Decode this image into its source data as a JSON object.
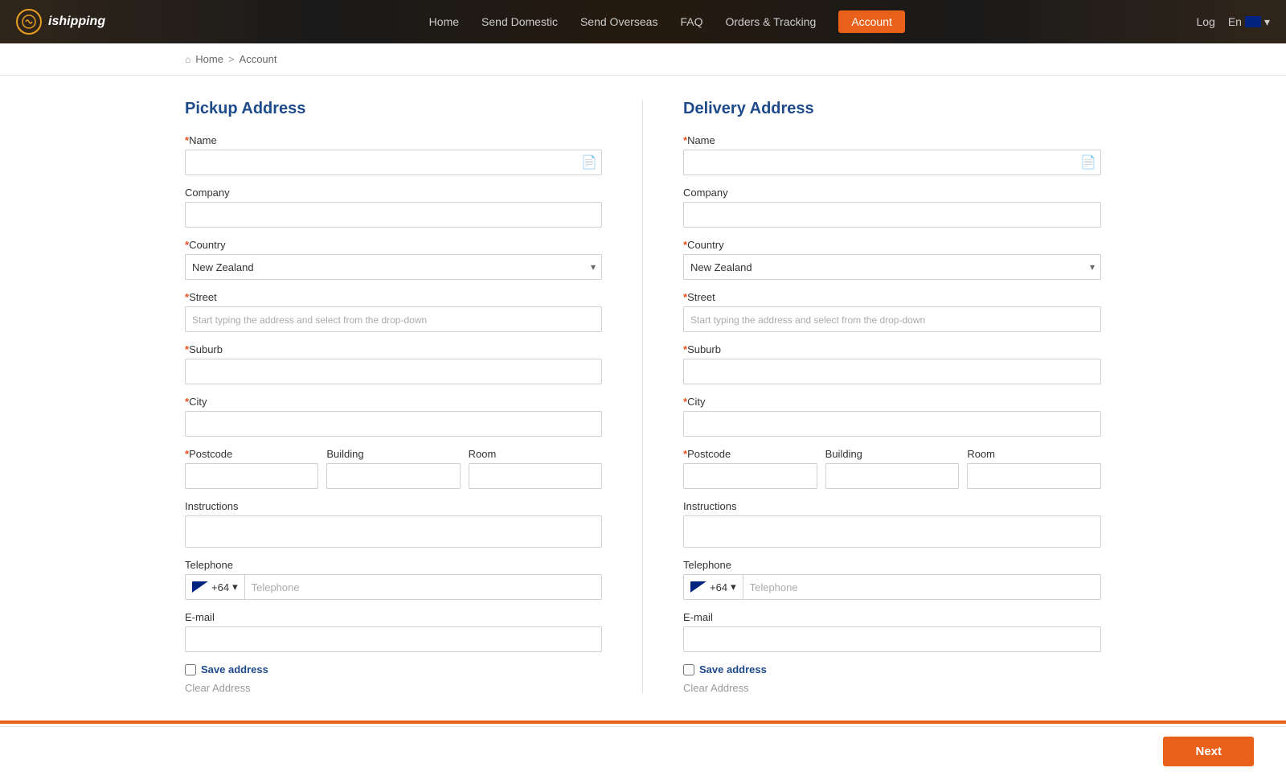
{
  "header": {
    "logo_text": "ishipping",
    "nav": {
      "home": "Home",
      "send_domestic": "Send Domestic",
      "send_overseas": "Send Overseas",
      "faq": "FAQ",
      "orders_tracking": "Orders & Tracking",
      "account": "Account",
      "log": "Log",
      "lang": "En"
    }
  },
  "breadcrumb": {
    "home": "Home",
    "separator": ">",
    "current": "Account"
  },
  "pickup": {
    "title": "Pickup Address",
    "name_label": "Name",
    "company_label": "Company",
    "country_label": "Country",
    "country_value": "New Zealand",
    "street_label": "Street",
    "street_placeholder": "Start typing the address and select from the drop-down",
    "suburb_label": "Suburb",
    "city_label": "City",
    "postcode_label": "Postcode",
    "building_label": "Building",
    "room_label": "Room",
    "instructions_label": "Instructions",
    "telephone_label": "Telephone",
    "phone_prefix": "+64",
    "phone_placeholder": "Telephone",
    "email_label": "E-mail",
    "save_address_label": "Save address",
    "clear_address_label": "Clear Address"
  },
  "delivery": {
    "title": "Delivery Address",
    "name_label": "Name",
    "company_label": "Company",
    "country_label": "Country",
    "country_value": "New Zealand",
    "street_label": "Street",
    "street_placeholder": "Start typing the address and select from the drop-down",
    "suburb_label": "Suburb",
    "city_label": "City",
    "postcode_label": "Postcode",
    "building_label": "Building",
    "room_label": "Room",
    "instructions_label": "Instructions",
    "telephone_label": "Telephone",
    "phone_prefix": "+64",
    "phone_placeholder": "Telephone",
    "email_label": "E-mail",
    "save_address_label": "Save address",
    "clear_address_label": "Clear Address"
  },
  "footer": {
    "next_button": "Next"
  }
}
